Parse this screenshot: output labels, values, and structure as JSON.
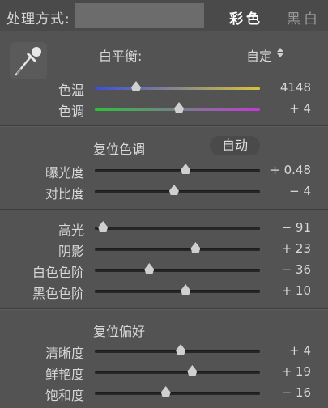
{
  "header": {
    "treatment_label": "处理方式:",
    "color_option": "彩色",
    "bw_option": "黑白"
  },
  "white_balance": {
    "label": "白平衡:",
    "value": "自定"
  },
  "wb_sliders": [
    {
      "label": "色温",
      "value": "4148",
      "level": 0.25
    },
    {
      "label": "色调",
      "value": "+ 4",
      "level": 0.51
    }
  ],
  "tone": {
    "reset_label": "复位色调",
    "auto_label": "自动"
  },
  "tone_sliders": [
    {
      "label": "曝光度",
      "value": "+ 0.48",
      "level": 0.55
    },
    {
      "label": "对比度",
      "value": "− 4",
      "level": 0.48
    }
  ],
  "presence_sliders": [
    {
      "label": "高光",
      "value": "− 91",
      "level": 0.05
    },
    {
      "label": "阴影",
      "value": "+ 23",
      "level": 0.61
    },
    {
      "label": "白色色阶",
      "value": "− 36",
      "level": 0.33
    },
    {
      "label": "黑色色阶",
      "value": "+ 10",
      "level": 0.55
    }
  ],
  "presence": {
    "reset_label": "复位偏好"
  },
  "pref_sliders": [
    {
      "label": "清晰度",
      "value": "+ 4",
      "level": 0.52
    },
    {
      "label": "鲜艳度",
      "value": "+ 19",
      "level": 0.59
    },
    {
      "label": "饱和度",
      "value": "− 16",
      "level": 0.43
    }
  ],
  "colors": {
    "temp_gradient": [
      "#3a4fd8",
      "#d8c23a"
    ],
    "tint_gradient": [
      "#2cc23a",
      "#c23ad8"
    ]
  }
}
